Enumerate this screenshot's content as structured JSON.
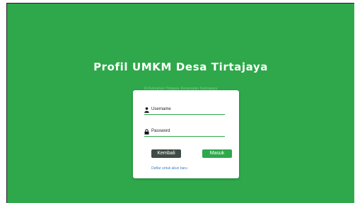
{
  "app": {
    "title": "Profil UMKM Desa Tirtajaya",
    "subtitle": "Di Kelurahan Tirtajaya, Kecamatan Sukmajaya"
  },
  "form": {
    "username_label": "Username",
    "password_label": "Password",
    "back_label": "Kembali",
    "login_label": "Masuk",
    "register_link": "Daftar untuk akun baru"
  },
  "colors": {
    "background": "#2ea84a",
    "primary": "#2ea84a",
    "back_button": "#3f4b44",
    "link": "#3d7fc4"
  },
  "icons": {
    "username": "user-icon",
    "password": "lock-icon"
  }
}
